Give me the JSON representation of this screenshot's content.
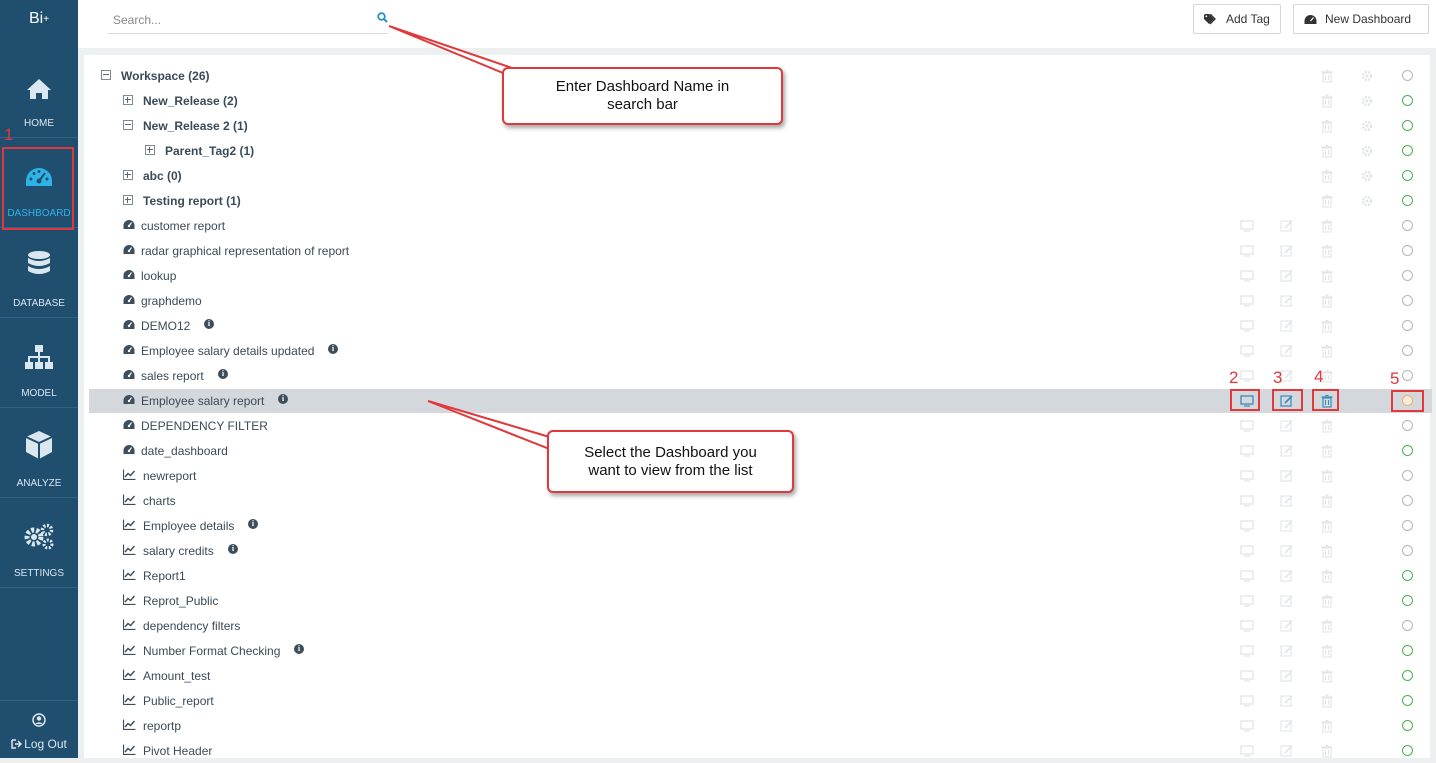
{
  "app": {
    "logo": "Bi",
    "logo_sup": "+"
  },
  "sidebar": {
    "items": [
      {
        "label": "HOME",
        "icon": "home-icon"
      },
      {
        "label": "DASHBOARD",
        "icon": "dashboard-gauge-icon",
        "active": true
      },
      {
        "label": "DATABASE",
        "icon": "database-icon"
      },
      {
        "label": "MODEL",
        "icon": "sitemap-icon"
      },
      {
        "label": "ANALYZE",
        "icon": "cube-icon"
      },
      {
        "label": "SETTINGS",
        "icon": "gears-icon"
      }
    ],
    "logout": "Log Out"
  },
  "topbar": {
    "search_placeholder": "Search...",
    "add_tag": "Add Tag",
    "new_dashboard": "New Dashboard"
  },
  "tree": {
    "folders": [
      {
        "label": "Workspace (26)",
        "expanded": true,
        "status": "off"
      },
      {
        "label": "New_Release (2)",
        "expanded": false,
        "status": "on"
      },
      {
        "label": "New_Release 2 (1)",
        "expanded": true,
        "status": "on"
      },
      {
        "label": "Parent_Tag2 (1)",
        "expanded": false,
        "status": "on"
      },
      {
        "label": "abc (0)",
        "expanded": false,
        "status": "on"
      },
      {
        "label": "Testing report (1)",
        "expanded": false,
        "status": "on"
      }
    ],
    "items": [
      {
        "label": "customer report",
        "type": "dashboard",
        "info": false,
        "status": "off"
      },
      {
        "label": "radar graphical representation of report",
        "type": "dashboard",
        "info": false,
        "status": "off"
      },
      {
        "label": "lookup",
        "type": "dashboard",
        "info": false,
        "status": "off"
      },
      {
        "label": "graphdemo",
        "type": "dashboard",
        "info": false,
        "status": "off"
      },
      {
        "label": "DEMO12",
        "type": "dashboard",
        "info": true,
        "status": "off"
      },
      {
        "label": "Employee salary details updated",
        "type": "dashboard",
        "info": true,
        "status": "off"
      },
      {
        "label": "sales report",
        "type": "dashboard",
        "info": true,
        "status": "off"
      },
      {
        "label": "Employee salary report",
        "type": "dashboard",
        "info": true,
        "status": "selected",
        "selected": true
      },
      {
        "label": "DEPENDENCY FILTER",
        "type": "dashboard",
        "info": false,
        "status": "off"
      },
      {
        "label": "date_dashboard",
        "type": "dashboard",
        "info": false,
        "status": "on"
      },
      {
        "label": "newreport",
        "type": "report",
        "info": false,
        "status": "off"
      },
      {
        "label": "charts",
        "type": "report",
        "info": false,
        "status": "off"
      },
      {
        "label": "Employee details",
        "type": "report",
        "info": true,
        "status": "off"
      },
      {
        "label": "salary credits",
        "type": "report",
        "info": true,
        "status": "off"
      },
      {
        "label": "Report1",
        "type": "report",
        "info": false,
        "status": "on"
      },
      {
        "label": "Reprot_Public",
        "type": "report",
        "info": false,
        "status": "on"
      },
      {
        "label": "dependency filters",
        "type": "report",
        "info": false,
        "status": "off"
      },
      {
        "label": "Number Format Checking",
        "type": "report",
        "info": true,
        "status": "on"
      },
      {
        "label": "Amount_test",
        "type": "report",
        "info": false,
        "status": "on"
      },
      {
        "label": "Public_report",
        "type": "report",
        "info": false,
        "status": "on"
      },
      {
        "label": "reportp",
        "type": "report",
        "info": false,
        "status": "on"
      },
      {
        "label": "Pivot Header",
        "type": "report",
        "info": false,
        "status": "on"
      }
    ]
  },
  "annotations": {
    "callout_search": "Enter Dashboard Name in search bar",
    "callout_select": "Select the Dashboard you want to view from the list",
    "numbers": [
      "1",
      "2",
      "3",
      "4",
      "5"
    ]
  },
  "colors": {
    "sidebar_bg": "#1f4e6e",
    "active_accent": "#2fb3e6",
    "annotation_red": "#e0383b",
    "status_on": "#4caf50",
    "status_off": "#b5b5b5"
  }
}
